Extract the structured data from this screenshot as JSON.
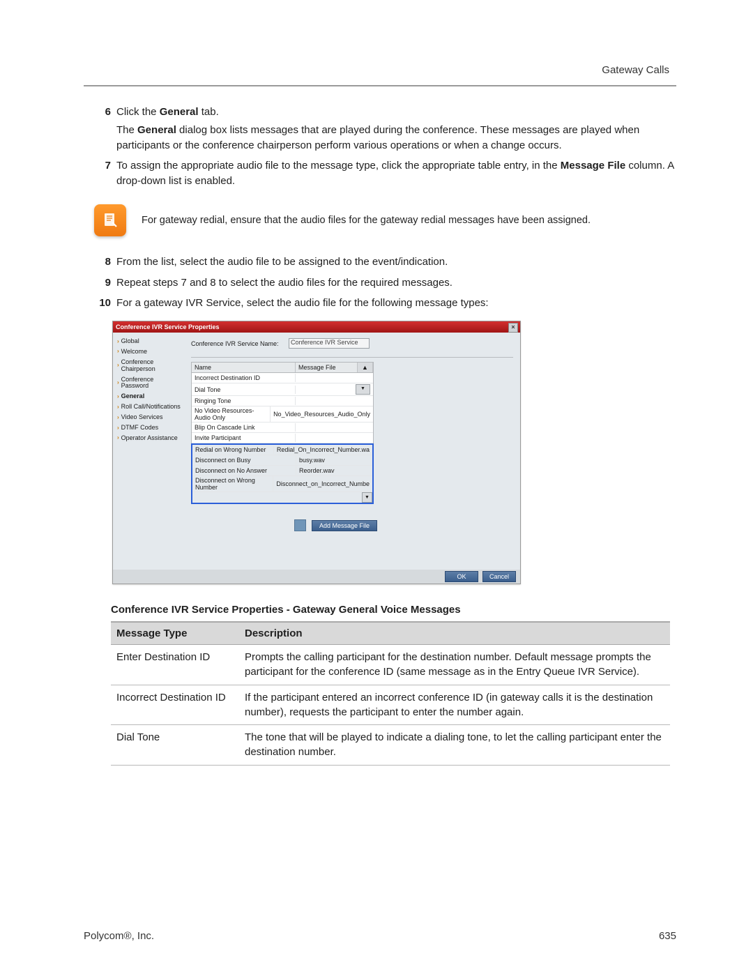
{
  "header": {
    "right": "Gateway Calls"
  },
  "steps": {
    "s6": {
      "num": "6",
      "line": "Click the ",
      "bold": "General",
      "tail": " tab.",
      "desc1": "The ",
      "desc1b": "General",
      "desc1c": " dialog box lists messages that are played during the conference. These messages are played when participants or the conference chairperson perform various operations or when a change occurs."
    },
    "s7": {
      "num": "7",
      "text": "To assign the appropriate audio file to the message type, click the appropriate table entry, in the ",
      "bold": "Message File",
      "tail": " column. A drop-down list is enabled."
    },
    "note": {
      "text": "For gateway redial, ensure that the audio files for the gateway redial messages have been assigned."
    },
    "s8": {
      "num": "8",
      "text": "From the list, select the audio file to be assigned to the event/indication."
    },
    "s9": {
      "num": "9",
      "text": "Repeat steps 7 and 8 to select the audio files for the required messages."
    },
    "s10": {
      "num": "10",
      "text": "For a gateway IVR Service, select the audio file for the following message types:"
    }
  },
  "dialog": {
    "title": "Conference IVR Service Properties",
    "closeGlyph": "×",
    "nav": [
      "Global",
      "Welcome",
      "Conference Chairperson",
      "Conference Password",
      "Roll Call/Notifications",
      "Video Services",
      "DTMF Codes",
      "Operator Assistance"
    ],
    "navActive": "General",
    "fieldLabel": "Conference IVR Service Name:",
    "fieldValue": "Conference IVR Service",
    "colName": "Name",
    "colFile": "Message File",
    "upGlyph": "▲",
    "downGlyph": "▼",
    "ddGlyph": "▼",
    "rows": [
      {
        "name": "Incorrect Destination ID",
        "file": ""
      },
      {
        "name": "Dial Tone",
        "file": "",
        "dd": true
      },
      {
        "name": "Ringing Tone",
        "file": ""
      },
      {
        "name": "No Video Resources-Audio Only",
        "file": "No_Video_Resources_Audio_Only"
      },
      {
        "name": "Blip On Cascade Link",
        "file": ""
      },
      {
        "name": "Invite Participant",
        "file": ""
      }
    ],
    "rowsH": [
      {
        "name": "Redial on Wrong Number",
        "file": "Redial_On_Incorrect_Number.wa"
      },
      {
        "name": "Disconnect on Busy",
        "file": "busy.wav"
      },
      {
        "name": "Disconnect on No Answer",
        "file": "Reorder.wav"
      },
      {
        "name": "Disconnect on Wrong Number",
        "file": "Disconnect_on_Incorrect_Numbe"
      }
    ],
    "addBtn": "Add Message File",
    "okBtn": "OK",
    "cancelBtn": "Cancel"
  },
  "tableCaption": "Conference IVR Service Properties - Gateway General Voice Messages",
  "table": {
    "h1": "Message Type",
    "h2": "Description",
    "rows": [
      {
        "c1": "Enter Destination ID",
        "c2": "Prompts the calling participant for the destination number. Default message prompts the participant for the conference ID (same message as in the Entry Queue IVR Service)."
      },
      {
        "c1": "Incorrect Destination ID",
        "c2": "If the participant entered an incorrect conference ID (in gateway calls it is the destination number), requests the participant to enter the number again."
      },
      {
        "c1": "Dial Tone",
        "c2": "The tone that will be played to indicate a dialing tone, to let the calling participant enter the destination number."
      }
    ]
  },
  "footer": {
    "left": "Polycom®, Inc.",
    "right": "635"
  }
}
